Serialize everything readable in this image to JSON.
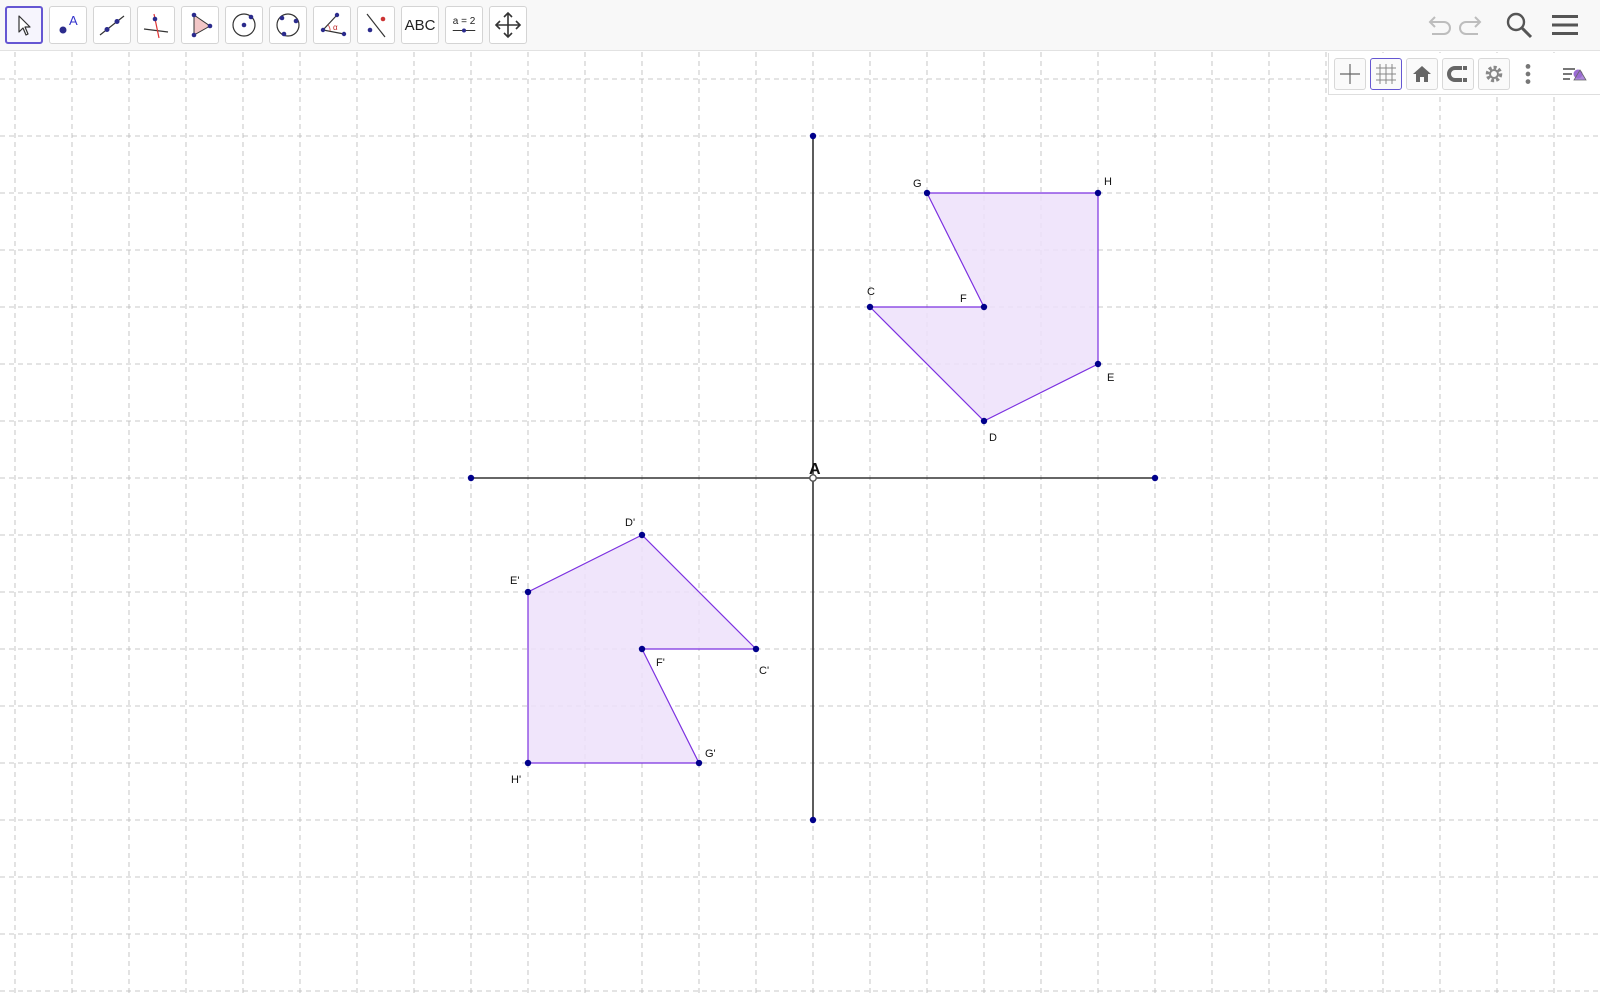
{
  "toolbar": {
    "tools": [
      {
        "name": "move-tool",
        "icon": "cursor-arrow-icon",
        "active": true
      },
      {
        "name": "point-tool",
        "icon": "point-icon",
        "label": "A"
      },
      {
        "name": "line-tool",
        "icon": "line-through-points-icon"
      },
      {
        "name": "perpendicular-line-tool",
        "icon": "perpendicular-line-icon"
      },
      {
        "name": "polygon-tool",
        "icon": "polygon-icon"
      },
      {
        "name": "circle-center-point-tool",
        "icon": "circle-center-icon"
      },
      {
        "name": "circle-three-points-tool",
        "icon": "circle-three-points-icon"
      },
      {
        "name": "angle-tool",
        "icon": "angle-icon",
        "label": "α"
      },
      {
        "name": "reflect-about-line-tool",
        "icon": "reflect-line-icon"
      },
      {
        "name": "text-tool",
        "icon": "text-icon",
        "label": "ABC"
      },
      {
        "name": "slider-tool",
        "icon": "slider-icon",
        "label": "a = 2"
      },
      {
        "name": "move-graphics-view-tool",
        "icon": "move-arrows-icon"
      }
    ],
    "right_controls": [
      "undo-icon",
      "redo-icon",
      "search-icon",
      "menu-icon"
    ]
  },
  "style_bar": {
    "buttons": [
      "axes-icon",
      "grid-icon",
      "home-icon",
      "point-capture-icon",
      "settings-gear-icon",
      "more-vertical-icon",
      "algebra-view-toggle-icon"
    ],
    "grid_active": true
  },
  "graphics": {
    "origin_label": "A",
    "grid": true,
    "axis_color": "#333333",
    "point_color": "#00008b",
    "polygon_stroke": "#7b30e0",
    "polygon_fill": "#ede1fa",
    "grid_color": "#b9b9b9",
    "segments": {
      "vertical": {
        "from": [
          0,
          6
        ],
        "to": [
          0,
          -6
        ]
      },
      "horizontal": {
        "from": [
          -6,
          0
        ],
        "to": [
          6,
          0
        ]
      }
    },
    "points": [
      {
        "name": "C",
        "x": 1,
        "y": 3
      },
      {
        "name": "D",
        "x": 3,
        "y": 1
      },
      {
        "name": "E",
        "x": 5,
        "y": 2
      },
      {
        "name": "H",
        "x": 5,
        "y": 5
      },
      {
        "name": "G",
        "x": 2,
        "y": 5
      },
      {
        "name": "F",
        "x": 3,
        "y": 3
      },
      {
        "name": "C'",
        "x": -1,
        "y": -3
      },
      {
        "name": "D'",
        "x": -3,
        "y": -1
      },
      {
        "name": "E'",
        "x": -5,
        "y": -2
      },
      {
        "name": "H'",
        "x": -5,
        "y": -5
      },
      {
        "name": "G'",
        "x": -2,
        "y": -5
      },
      {
        "name": "F'",
        "x": -3,
        "y": -3
      }
    ],
    "polygons": [
      {
        "name": "polygon-cdehgf",
        "vertices": [
          "C",
          "D",
          "E",
          "H",
          "G",
          "F"
        ]
      },
      {
        "name": "polygon-cdehgf-image",
        "vertices": [
          "C'",
          "D'",
          "E'",
          "H'",
          "G'",
          "F'"
        ]
      }
    ]
  }
}
